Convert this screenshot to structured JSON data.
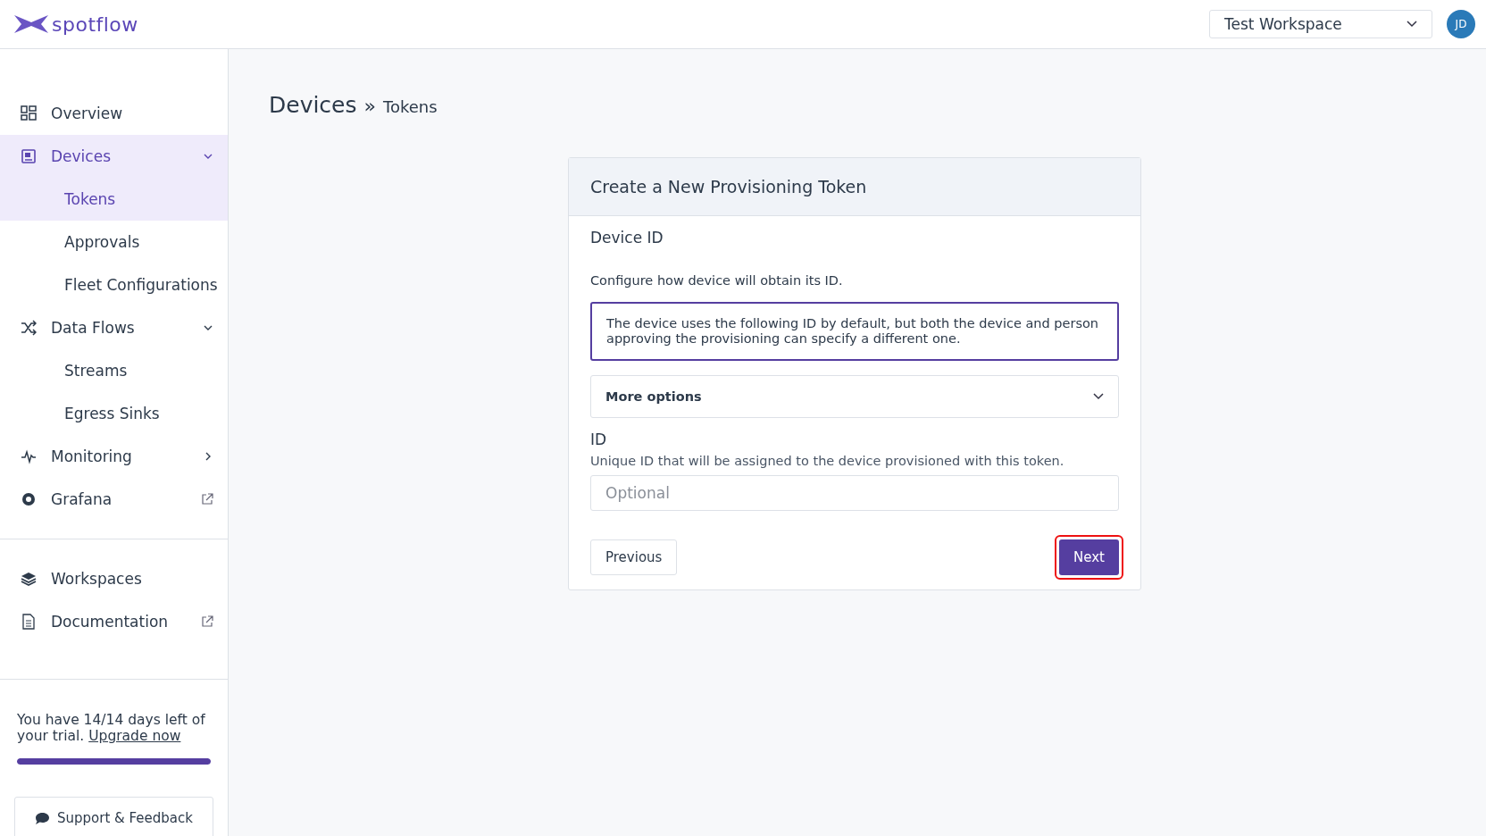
{
  "header": {
    "logo": "spotflow",
    "workspace": "Test Workspace",
    "avatar": "JD"
  },
  "sidebar": {
    "groups": [
      {
        "items": [
          {
            "label": "Overview",
            "selected": false
          },
          {
            "label": "Devices",
            "selected": true,
            "expanded": true,
            "children": [
              {
                "label": "Tokens",
                "selected": true
              },
              {
                "label": "Approvals",
                "selected": false
              },
              {
                "label": "Fleet Configurations",
                "selected": false
              }
            ]
          },
          {
            "label": "Data Flows",
            "selected": false,
            "expanded": true,
            "children": [
              {
                "label": "Streams",
                "selected": false
              },
              {
                "label": "Egress Sinks",
                "selected": false
              }
            ]
          },
          {
            "label": "Monitoring",
            "selected": false,
            "expanded": false
          },
          {
            "label": "Grafana",
            "selected": false,
            "external": true
          }
        ]
      },
      {
        "items": [
          {
            "label": "Workspaces",
            "selected": false
          },
          {
            "label": "Documentation",
            "selected": false,
            "external": true
          }
        ]
      }
    ],
    "trial": {
      "text": "You have 14/14 days left of your trial.",
      "link": "Upgrade now",
      "level": 1
    },
    "support": "Support & Feedback"
  },
  "breadcrumb": [
    "Devices",
    "»",
    "Tokens"
  ],
  "card": {
    "title": "Create a New Provisioning Token",
    "section": "Device ID",
    "description": "Configure how device will obtain its ID.",
    "info": "The device uses the following ID by default, but both the device and person approving the provisioning can specify a different one.",
    "more_options": {
      "label": "More options",
      "expanded": false
    },
    "field": {
      "label": "ID",
      "help": "Unique ID that will be assigned to the device provisioned with this token.",
      "placeholder": "Optional"
    },
    "buttons": [
      {
        "label": "Previous",
        "kind": "secondary",
        "focused": false
      },
      {
        "label": "Next",
        "kind": "primary",
        "focused": true
      }
    ]
  }
}
